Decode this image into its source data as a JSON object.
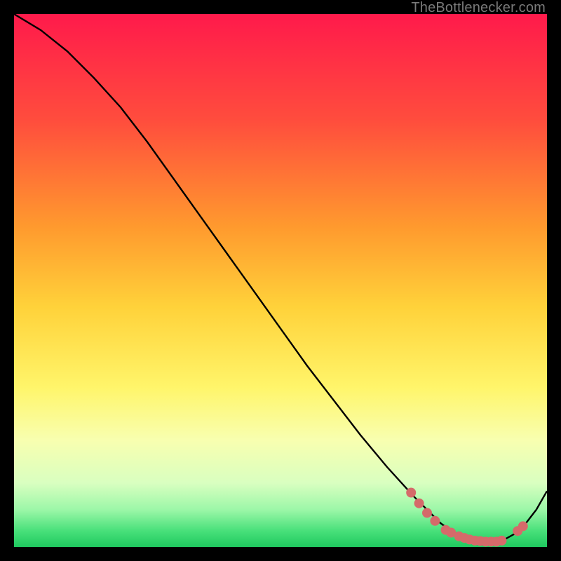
{
  "watermark": "TheBottlenecker.com",
  "chart_data": {
    "type": "line",
    "title": "",
    "xlabel": "",
    "ylabel": "",
    "xlim": [
      0,
      100
    ],
    "ylim": [
      0,
      100
    ],
    "gradient_stops": [
      {
        "offset": 0,
        "color": "#ff1a4b"
      },
      {
        "offset": 20,
        "color": "#ff4d3d"
      },
      {
        "offset": 40,
        "color": "#ff9a2e"
      },
      {
        "offset": 55,
        "color": "#ffd23a"
      },
      {
        "offset": 70,
        "color": "#fff56a"
      },
      {
        "offset": 80,
        "color": "#f8ffb0"
      },
      {
        "offset": 88,
        "color": "#d9ffc0"
      },
      {
        "offset": 93,
        "color": "#9cf7a8"
      },
      {
        "offset": 97,
        "color": "#48e07a"
      },
      {
        "offset": 100,
        "color": "#1fc95f"
      }
    ],
    "series": [
      {
        "name": "bottleneck-curve",
        "x": [
          0,
          5,
          10,
          15,
          20,
          25,
          30,
          35,
          40,
          45,
          50,
          55,
          60,
          65,
          70,
          75,
          78,
          80,
          82,
          84,
          86,
          88,
          90,
          92,
          94,
          96,
          98,
          100
        ],
        "y": [
          100,
          97,
          93,
          88,
          82.5,
          76,
          69,
          62,
          55,
          48,
          41,
          34,
          27.5,
          21,
          15,
          9.5,
          6.5,
          4.5,
          3.0,
          2.0,
          1.4,
          1.0,
          1.0,
          1.4,
          2.5,
          4.4,
          7.0,
          10.5
        ]
      }
    ],
    "markers": {
      "name": "highlight-dots",
      "color": "#d56a6a",
      "r": 7,
      "points": [
        {
          "x": 74.5,
          "y": 10.2
        },
        {
          "x": 76.0,
          "y": 8.2
        },
        {
          "x": 77.5,
          "y": 6.4
        },
        {
          "x": 79.0,
          "y": 4.9
        },
        {
          "x": 81.0,
          "y": 3.2
        },
        {
          "x": 82.0,
          "y": 2.7
        },
        {
          "x": 83.5,
          "y": 2.0
        },
        {
          "x": 84.5,
          "y": 1.7
        },
        {
          "x": 85.5,
          "y": 1.4
        },
        {
          "x": 86.5,
          "y": 1.2
        },
        {
          "x": 87.5,
          "y": 1.1
        },
        {
          "x": 88.5,
          "y": 1.0
        },
        {
          "x": 89.5,
          "y": 1.0
        },
        {
          "x": 90.5,
          "y": 1.0
        },
        {
          "x": 91.5,
          "y": 1.2
        },
        {
          "x": 94.5,
          "y": 3.0
        },
        {
          "x": 95.5,
          "y": 3.9
        }
      ]
    }
  }
}
